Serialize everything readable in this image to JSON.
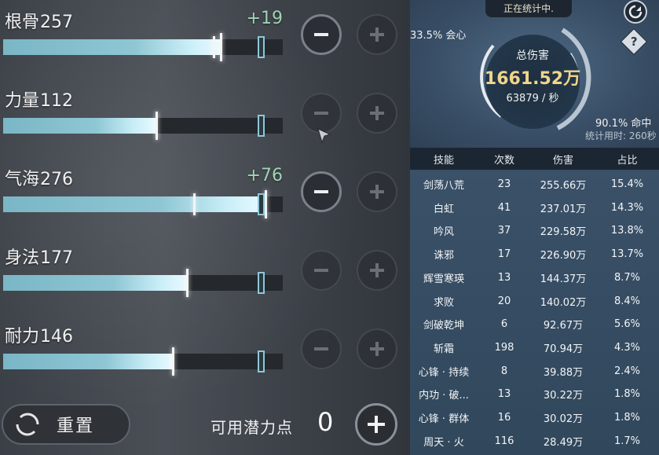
{
  "stats": [
    {
      "label": "根骨",
      "value": "257",
      "delta": "+19",
      "base_ratio": 0.75,
      "total_ratio": 0.78,
      "minus_enabled": true
    },
    {
      "label": "力量",
      "value": "112",
      "delta": "",
      "base_ratio": 0.55,
      "total_ratio": 0.55,
      "minus_enabled": false
    },
    {
      "label": "气海",
      "value": "276",
      "delta": "+76",
      "base_ratio": 0.68,
      "total_ratio": 0.94,
      "minus_enabled": true
    },
    {
      "label": "身法",
      "value": "177",
      "delta": "",
      "base_ratio": 0.66,
      "total_ratio": 0.66,
      "minus_enabled": false
    },
    {
      "label": "耐力",
      "value": "146",
      "delta": "",
      "base_ratio": 0.61,
      "total_ratio": 0.61,
      "minus_enabled": false
    }
  ],
  "footer": {
    "reset_label": "重置",
    "points_label": "可用潜力点",
    "points_value": "0"
  },
  "summary": {
    "status": "正在统计中.",
    "crit": "33.5% 会心",
    "title": "总伤害",
    "total": "1661.52万",
    "rate": "63879 / 秒",
    "hit": "90.1% 命中",
    "duration": "统计用时: 260秒",
    "help": "?"
  },
  "table": {
    "headers": [
      "技能",
      "次数",
      "伤害",
      "占比"
    ],
    "rows": [
      [
        "剑荡八荒",
        "23",
        "255.66万",
        "15.4%"
      ],
      [
        "白虹",
        "41",
        "237.01万",
        "14.3%"
      ],
      [
        "吟风",
        "37",
        "229.58万",
        "13.8%"
      ],
      [
        "诛邪",
        "17",
        "226.90万",
        "13.7%"
      ],
      [
        "辉雪寒瑛",
        "13",
        "144.37万",
        "8.7%"
      ],
      [
        "求败",
        "20",
        "140.02万",
        "8.4%"
      ],
      [
        "剑破乾坤",
        "6",
        "92.67万",
        "5.6%"
      ],
      [
        "斩霜",
        "198",
        "70.94万",
        "4.3%"
      ],
      [
        "心锋 · 持续",
        "8",
        "39.88万",
        "2.4%"
      ],
      [
        "内功 · 破...",
        "13",
        "30.22万",
        "1.8%"
      ],
      [
        "心锋 · 群体",
        "16",
        "30.02万",
        "1.8%"
      ],
      [
        "周天 · 火",
        "116",
        "28.49万",
        "1.7%"
      ]
    ]
  },
  "colors": {
    "bar_fill": "#8ec6d4",
    "delta": "#9fd4b4",
    "total": "#f0d58c"
  }
}
